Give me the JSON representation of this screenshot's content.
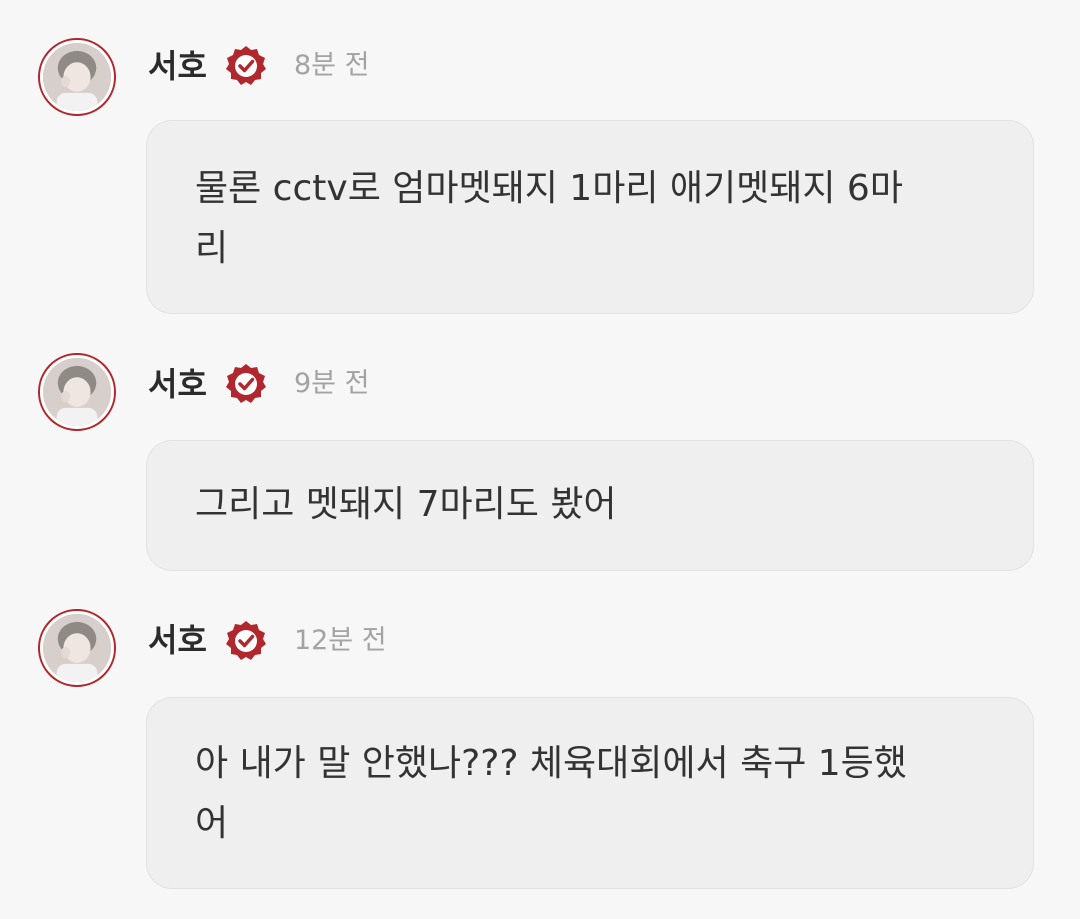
{
  "messages": [
    {
      "sender": "서호",
      "time": "8분 전",
      "text": "물론 cctv로 엄마멧돼지 1마리 애기멧돼지 6마\n리"
    },
    {
      "sender": "서호",
      "time": "9분 전",
      "text": "그리고 멧돼지 7마리도 봤어"
    },
    {
      "sender": "서호",
      "time": "12분 전",
      "text": "아 내가 말 안했나??? 체육대회에서 축구 1등했\n어"
    }
  ],
  "icons": {
    "verified": "verified-badge-icon",
    "avatar": "profile-avatar"
  },
  "colors": {
    "accent": "#b0282e",
    "background": "#f7f7f7",
    "bubble": "#efefef",
    "timestamp": "#a3a3a3"
  }
}
